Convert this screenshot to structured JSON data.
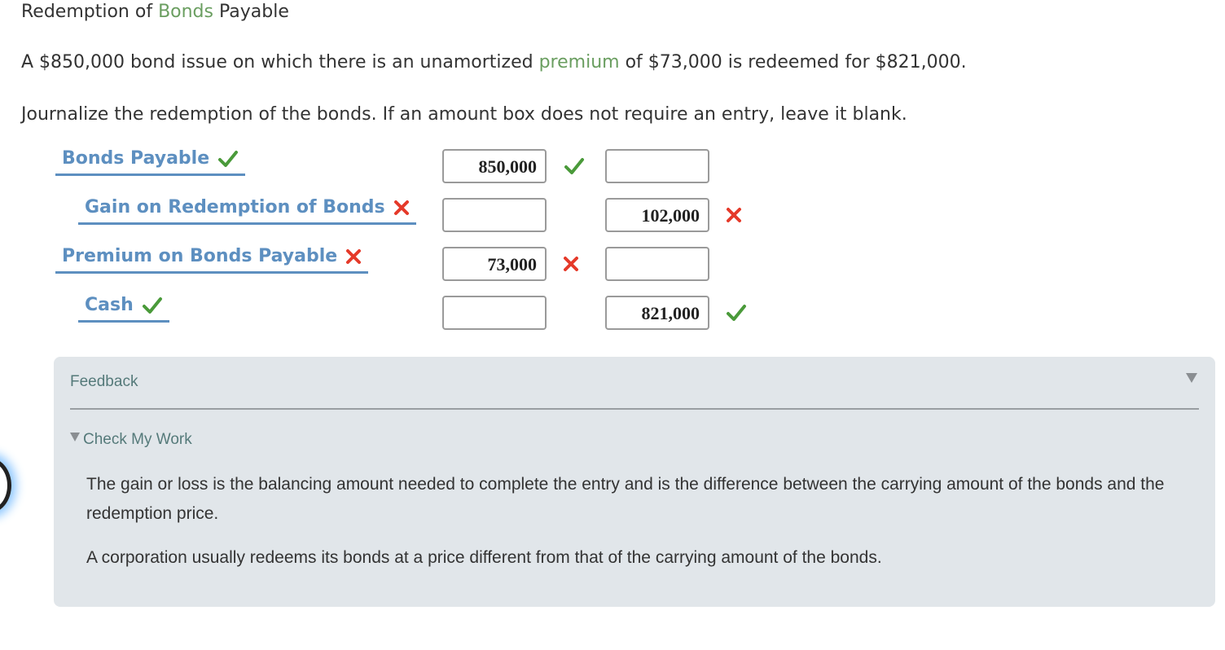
{
  "title": {
    "prefix": "Redemption of ",
    "highlight": "Bonds",
    "suffix": " Payable"
  },
  "problem": {
    "prefix": "A $850,000 bond issue on which there is an unamortized ",
    "highlight": "premium",
    "suffix": " of $73,000 is redeemed for $821,000."
  },
  "instructions": "Journalize the redemption of the bonds. If an amount box does not require an entry, leave it blank.",
  "journal": [
    {
      "account": "Bonds Payable",
      "account_status": "correct",
      "debit": "850,000",
      "debit_status": "correct",
      "credit": "",
      "credit_status": ""
    },
    {
      "account": "Gain on Redemption of Bonds",
      "account_status": "incorrect",
      "debit": "",
      "debit_status": "",
      "credit": "102,000",
      "credit_status": "incorrect"
    },
    {
      "account": "Premium on Bonds Payable",
      "account_status": "incorrect",
      "debit": "73,000",
      "debit_status": "incorrect",
      "credit": "",
      "credit_status": ""
    },
    {
      "account": "Cash",
      "account_status": "correct",
      "debit": "",
      "debit_status": "",
      "credit": "821,000",
      "credit_status": "correct"
    }
  ],
  "feedback": {
    "title": "Feedback",
    "check_my_work": "Check My Work",
    "paragraphs": [
      "The gain or loss is the balancing amount needed to complete the entry and is the difference between the carrying amount of the bonds and the redemption price.",
      "A corporation usually redeems its bonds at a price different from that of the carrying amount of the bonds."
    ]
  },
  "colors": {
    "accent_green": "#6a9e60",
    "account_blue": "#5d8fc0",
    "correct": "#4a9a3a",
    "incorrect": "#e53a2a",
    "feedback_bg": "#e1e6ea"
  }
}
